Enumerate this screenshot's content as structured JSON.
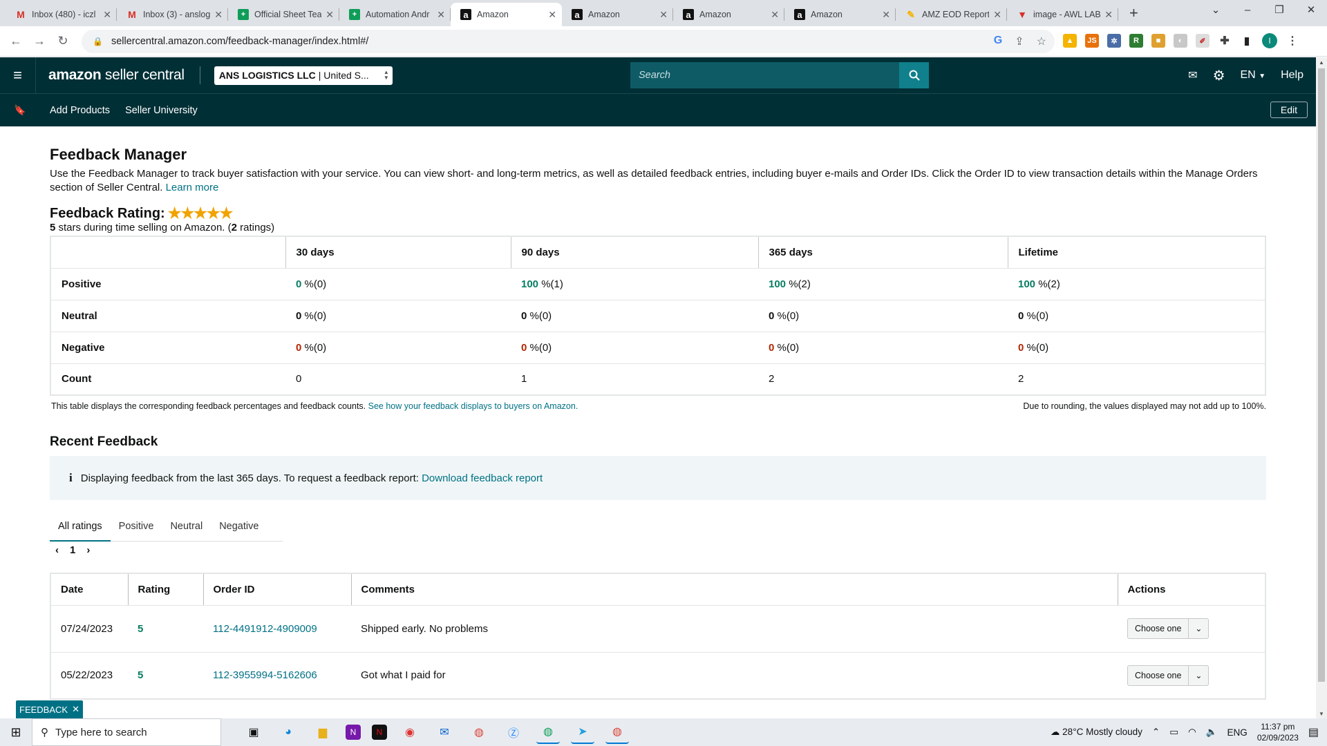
{
  "browser": {
    "tabs": [
      {
        "icon": "gmail-icon",
        "glyph": "M",
        "title": "Inbox (480) - iczl",
        "active": false
      },
      {
        "icon": "gmail-icon",
        "glyph": "M",
        "title": "Inbox (3) - anslog",
        "active": false
      },
      {
        "icon": "sheets-icon",
        "glyph": "+",
        "title": "Official Sheet Tea",
        "active": false
      },
      {
        "icon": "sheets-icon",
        "glyph": "+",
        "title": "Automation Andr",
        "active": false
      },
      {
        "icon": "amazon-icon",
        "glyph": "a",
        "title": "Amazon",
        "active": true
      },
      {
        "icon": "amazon-icon",
        "glyph": "a",
        "title": "Amazon",
        "active": false
      },
      {
        "icon": "amazon-icon",
        "glyph": "a",
        "title": "Amazon",
        "active": false
      },
      {
        "icon": "amazon-icon",
        "glyph": "a",
        "title": "Amazon",
        "active": false
      },
      {
        "icon": "report-icon",
        "glyph": "✎",
        "title": "AMZ EOD Report",
        "active": false
      },
      {
        "icon": "awl-icon",
        "glyph": "▼",
        "title": "image - AWL LAB",
        "active": false
      }
    ],
    "url": "sellercentral.amazon.com/feedback-manager/index.html#/"
  },
  "header": {
    "logo_bold": "amazon",
    "logo_light": " seller central",
    "account_name": "ANS LOGISTICS LLC",
    "account_region": "| United S...",
    "search_placeholder": "Search",
    "language": "EN",
    "help": "Help"
  },
  "subnav": {
    "links": [
      "Add Products",
      "Seller University"
    ],
    "edit": "Edit"
  },
  "page": {
    "title": "Feedback Manager",
    "intro": "Use the Feedback Manager to track buyer satisfaction with your service. You can view short- and long-term metrics, as well as detailed feedback entries, including buyer e-mails and Order IDs. Click the Order ID to view transaction details within the Manage Orders section of Seller Central.",
    "learn_more": "Learn more",
    "rating_label": "Feedback Rating:",
    "star_count": 5,
    "rating_stars": "5",
    "rating_text_1": " stars during time selling on Amazon. (",
    "rating_count": "2",
    "rating_text_2": " ratings)"
  },
  "metrics": {
    "columns": [
      "30 days",
      "90 days",
      "365 days",
      "Lifetime"
    ],
    "rows": [
      {
        "label": "Positive",
        "cells": [
          {
            "v": "0",
            "rest": " %(0)",
            "tone": "g"
          },
          {
            "v": "100",
            "rest": " %(1)",
            "tone": "g"
          },
          {
            "v": "100",
            "rest": " %(2)",
            "tone": "g"
          },
          {
            "v": "100",
            "rest": " %(2)",
            "tone": "g"
          }
        ]
      },
      {
        "label": "Neutral",
        "cells": [
          {
            "v": "0",
            "rest": " %(0)",
            "tone": "nb"
          },
          {
            "v": "0",
            "rest": " %(0)",
            "tone": "nb"
          },
          {
            "v": "0",
            "rest": " %(0)",
            "tone": "nb"
          },
          {
            "v": "0",
            "rest": " %(0)",
            "tone": "nb"
          }
        ]
      },
      {
        "label": "Negative",
        "cells": [
          {
            "v": "0",
            "rest": " %(0)",
            "tone": "r"
          },
          {
            "v": "0",
            "rest": " %(0)",
            "tone": "r"
          },
          {
            "v": "0",
            "rest": " %(0)",
            "tone": "r"
          },
          {
            "v": "0",
            "rest": " %(0)",
            "tone": "r"
          }
        ]
      },
      {
        "label": "Count",
        "cells": [
          {
            "v": "",
            "rest": "0",
            "tone": ""
          },
          {
            "v": "",
            "rest": "1",
            "tone": ""
          },
          {
            "v": "",
            "rest": "2",
            "tone": ""
          },
          {
            "v": "",
            "rest": "2",
            "tone": ""
          }
        ]
      }
    ],
    "note": "This table displays the corresponding feedback percentages and feedback counts.",
    "note_link": "See how your feedback displays to buyers on Amazon.",
    "rounding_note": "Due to rounding, the values displayed may not add up to 100%."
  },
  "recent": {
    "title": "Recent Feedback",
    "info_text": "Displaying feedback from the last 365 days. To request a feedback report:",
    "info_link": "Download feedback report",
    "tabs": [
      "All ratings",
      "Positive",
      "Neutral",
      "Negative"
    ],
    "page": "1",
    "columns": [
      "Date",
      "Rating",
      "Order ID",
      "Comments",
      "Actions"
    ],
    "rows": [
      {
        "date": "07/24/2023",
        "rating": "5",
        "order_id": "112-4491912-4909009",
        "comment": "Shipped early. No problems",
        "action": "Choose one"
      },
      {
        "date": "05/22/2023",
        "rating": "5",
        "order_id": "112-3955994-5162606",
        "comment": "Got what I paid for",
        "action": "Choose one"
      }
    ]
  },
  "feedback_pill": "FEEDBACK",
  "taskbar": {
    "search_placeholder": "Type here to search",
    "weather": "28°C  Mostly cloudy",
    "lang": "ENG",
    "time": "11:37 pm",
    "date": "02/09/2023"
  },
  "colors": {
    "header_bg": "#002f36",
    "link": "#007185",
    "positive": "#067d62",
    "negative": "#b12704",
    "star": "#f0a300"
  }
}
